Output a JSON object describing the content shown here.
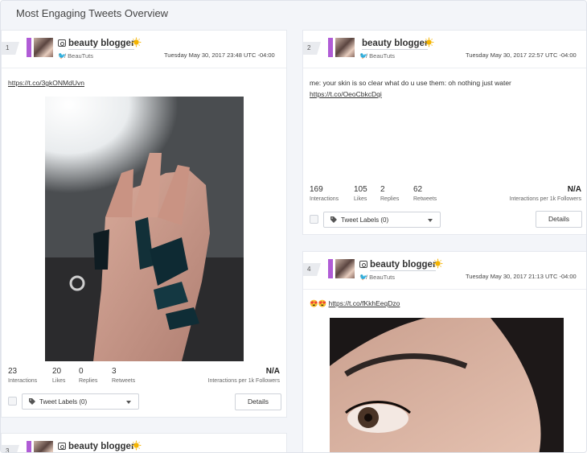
{
  "page": {
    "title": "Most Engaging Tweets Overview"
  },
  "cards": [
    {
      "rank": "1",
      "user_name": "beauty blogger",
      "handle": "/ BeauTuts",
      "date": "Tuesday May 30, 2017 23:48 UTC -04:00",
      "text_prefix": "",
      "link": "https://t.co/3gkONMdUvn",
      "interactions": "23",
      "likes": "20",
      "replies": "0",
      "retweets": "3",
      "per_1k": "N/A",
      "labels_button": "Tweet Labels (0)",
      "details_button": "Details"
    },
    {
      "rank": "2",
      "user_name": "beauty blogger",
      "handle": "/ BeauTuts",
      "date": "Tuesday May 30, 2017 22:57 UTC -04:00",
      "text_prefix": "me: your skin is so clear what do u use them: oh nothing just water",
      "link": "https://t.co/OeoCbkcDqi",
      "interactions": "169",
      "likes": "105",
      "replies": "2",
      "retweets": "62",
      "per_1k": "N/A",
      "labels_button": "Tweet Labels (0)",
      "details_button": "Details"
    },
    {
      "rank": "4",
      "user_name": "beauty blogger",
      "handle": "/ BeauTuts",
      "date": "Tuesday May 30, 2017 21:13 UTC -04:00",
      "text_prefix": "😍😍",
      "link": "https://t.co/fKkhEeqDzo"
    },
    {
      "rank": "3",
      "user_name": "beauty blogger"
    }
  ],
  "stat_labels": {
    "interactions": "Interactions",
    "likes": "Likes",
    "replies": "Replies",
    "retweets": "Retweets",
    "per_1k": "Interactions per 1k Followers"
  },
  "colors": {
    "accent_bar": "#b05cd6",
    "sun_badge": "#f5b400",
    "twitter_bird": "#9aa3ad"
  },
  "icons": [
    "camera-icon",
    "sun-icon",
    "twitter-bird-icon",
    "tag-icon",
    "chevron-down-icon"
  ]
}
